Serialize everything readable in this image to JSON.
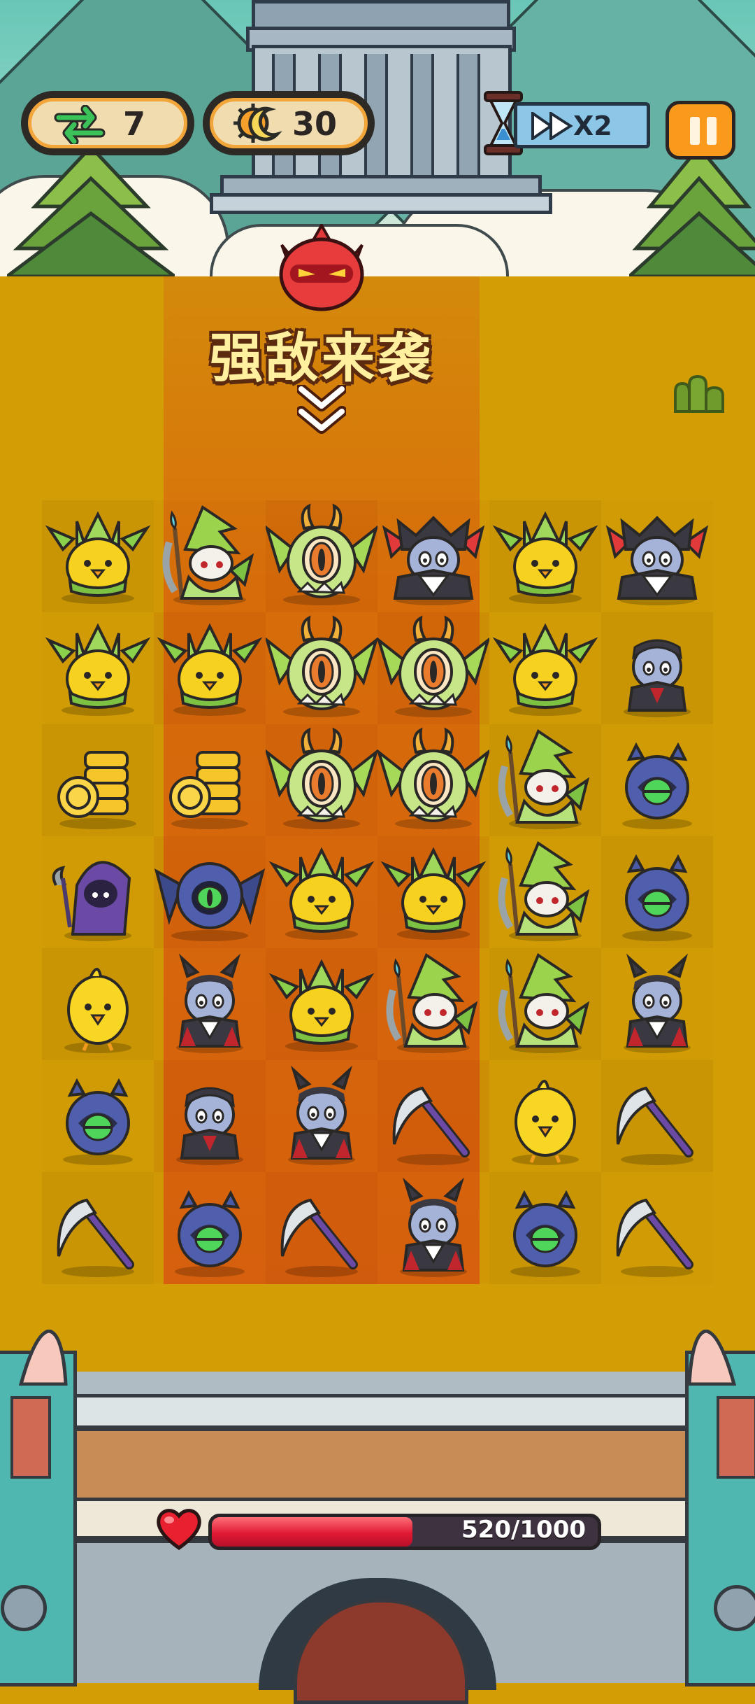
{
  "hud": {
    "swaps_icon": "swap-arrows-icon",
    "swaps_count": "7",
    "coins_icon": "gear-moon-icon",
    "coins_count": "30",
    "speed_label": "X2",
    "speed_icon": "fast-forward-icon",
    "timer_icon": "hourglass-icon",
    "pause_icon": "pause-icon"
  },
  "banner": {
    "boss_icon": "demon-head-icon",
    "warning_text": "强敌来袭",
    "arrow_icon": "double-chevron-down-icon"
  },
  "board": {
    "rows": [
      [
        "leaf-chick",
        "wizard",
        "dragon",
        "vampire-boss",
        "leaf-chick",
        "vampire-boss"
      ],
      [
        "leaf-chick",
        "leaf-chick",
        "dragon",
        "dragon",
        "leaf-chick",
        "vampire-small"
      ],
      [
        "coin-stack",
        "coin-stack",
        "dragon",
        "dragon",
        "wizard",
        "blob"
      ],
      [
        "purple-reaper",
        "bat-blob",
        "leaf-chick",
        "leaf-chick",
        "wizard",
        "blob"
      ],
      [
        "chick",
        "vampire",
        "leaf-chick",
        "wizard",
        "wizard",
        "vampire"
      ],
      [
        "blob",
        "vampire-small",
        "vampire",
        "scythe",
        "chick",
        "scythe"
      ],
      [
        "scythe",
        "blob",
        "scythe",
        "vampire",
        "blob",
        "scythe"
      ]
    ]
  },
  "base": {
    "hp_text": "520/1000",
    "hp_current": 520,
    "hp_max": 1000,
    "heart_icon": "heart-icon"
  },
  "colors": {
    "board_bg": "#d39d05",
    "lane": "#d9620e",
    "hp_fill": "#e01934",
    "pause_button": "#f99a1d"
  }
}
